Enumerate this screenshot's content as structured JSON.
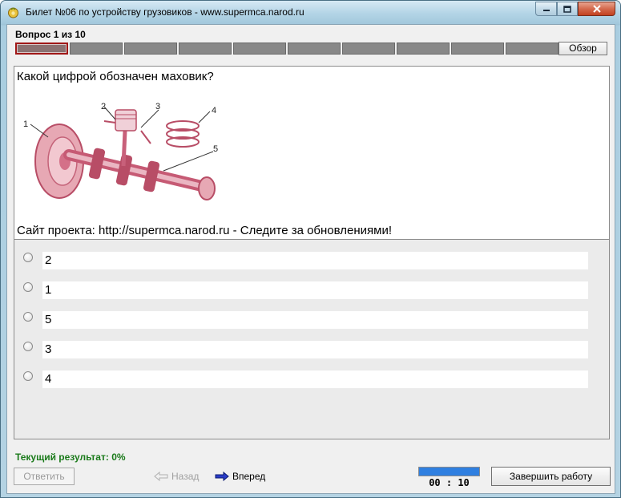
{
  "window": {
    "title": "Билет №06 по устройству грузовиков - www.supermca.narod.ru",
    "icon": "app-icon"
  },
  "header": {
    "question_counter": "Вопрос 1 из 10",
    "overview_label": "Обзор",
    "progress": {
      "total": 10,
      "current": 1
    }
  },
  "question": {
    "text": "Какой цифрой обозначен маховик?",
    "image_labels": [
      "1",
      "2",
      "3",
      "4",
      "5"
    ],
    "project_site": "Сайт проекта:  http://supermca.narod.ru - Следите за обновлениями!"
  },
  "answers": [
    {
      "label": "2"
    },
    {
      "label": "1"
    },
    {
      "label": "5"
    },
    {
      "label": "3"
    },
    {
      "label": "4"
    }
  ],
  "footer": {
    "result": "Текущий результат: 0%",
    "answer_label": "Ответить",
    "back_label": "Назад",
    "forward_label": "Вперед",
    "timer": "00 : 10",
    "timer_fraction": 1.0,
    "finish_label": "Завершить работу"
  },
  "colors": {
    "result_text": "#1a7a1a",
    "current_cell_border": "#a01818",
    "timer_fill": "#2f7fe0"
  }
}
